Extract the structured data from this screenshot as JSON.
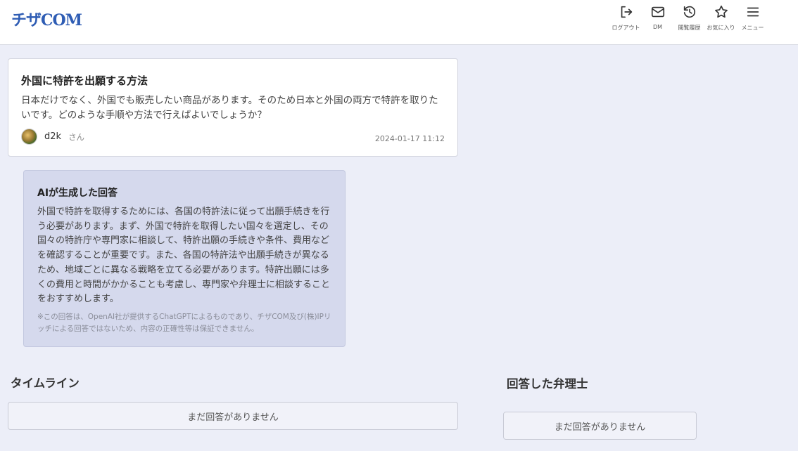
{
  "header": {
    "logo": "チザCOM",
    "nav": [
      {
        "label": "ログアウト",
        "icon": "logout-icon"
      },
      {
        "label": "DM",
        "icon": "mail-icon"
      },
      {
        "label": "閲覧履歴",
        "icon": "history-icon"
      },
      {
        "label": "お気に入り",
        "icon": "star-icon"
      },
      {
        "label": "メニュー",
        "icon": "menu-icon"
      }
    ]
  },
  "question": {
    "title": "外国に特許を出願する方法",
    "body": "日本だけでなく、外国でも販売したい商品があります。そのため日本と外国の両方で特許を取りたいです。どのような手順や方法で行えばよいでしょうか？",
    "author": "d2k",
    "author_suffix": "さん",
    "timestamp": "2024-01-17 11:12"
  },
  "ai_answer": {
    "title": "AIが生成した回答",
    "body": "外国で特許を取得するためには、各国の特許法に従って出願手続きを行う必要があります。まず、外国で特許を取得したい国々を選定し、その国々の特許庁や専門家に相談して、特許出願の手続きや条件、費用などを確認することが重要です。また、各国の特許法や出願手続きが異なるため、地域ごとに異なる戦略を立てる必要があります。特許出願には多くの費用と時間がかかることも考慮し、専門家や弁理士に相談することをおすすめします。",
    "note": "※この回答は、OpenAI社が提供するChatGPTによるものであり、チザCOM及び(株)IPリッチによる回答ではないため、内容の正確性等は保証できません。"
  },
  "timeline": {
    "title": "タイムライン",
    "empty": "まだ回答がありません"
  },
  "answered_attorneys": {
    "title": "回答した弁理士",
    "empty": "まだ回答がありません"
  },
  "colors": {
    "page_bg": "#eceef8",
    "ai_box_bg": "#d5d9ed",
    "brand": "#2f5db4"
  }
}
